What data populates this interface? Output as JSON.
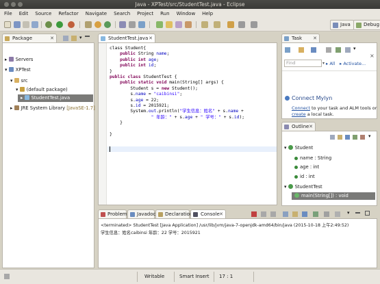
{
  "window": {
    "title": "Java - XPTest/src/StudentTest.java - Eclipse"
  },
  "menu": [
    "File",
    "Edit",
    "Source",
    "Refactor",
    "Navigate",
    "Search",
    "Project",
    "Run",
    "Window",
    "Help"
  ],
  "perspectives": {
    "java": "Java",
    "debug": "Debug"
  },
  "package_explorer": {
    "tab": "Package Explorer",
    "items": [
      "Servers",
      "XPTest",
      "src",
      "(default package)",
      "StudentTest.java",
      "JRE System Library",
      "[JavaSE-1.7]"
    ]
  },
  "editor": {
    "tab": "StudentTest.java",
    "lines": [
      [
        [
          "t",
          "class Student{"
        ]
      ],
      [
        [
          "t",
          "    "
        ],
        [
          "k",
          "public"
        ],
        [
          "t",
          " String "
        ],
        [
          "f",
          "name"
        ],
        [
          "t",
          ";"
        ]
      ],
      [
        [
          "t",
          "    "
        ],
        [
          "k",
          "public"
        ],
        [
          "t",
          " "
        ],
        [
          "k",
          "int"
        ],
        [
          "t",
          " "
        ],
        [
          "f",
          "age"
        ],
        [
          "t",
          ";"
        ]
      ],
      [
        [
          "t",
          "    "
        ],
        [
          "k",
          "public"
        ],
        [
          "t",
          " "
        ],
        [
          "k",
          "int"
        ],
        [
          "t",
          " "
        ],
        [
          "f",
          "id"
        ],
        [
          "t",
          ";"
        ]
      ],
      [
        [
          "t",
          "}"
        ]
      ],
      [
        [
          "k",
          "public"
        ],
        [
          "t",
          " "
        ],
        [
          "k",
          "class"
        ],
        [
          "t",
          " StudentTest {"
        ]
      ],
      [
        [
          "t",
          "    "
        ],
        [
          "k",
          "public"
        ],
        [
          "t",
          " "
        ],
        [
          "k",
          "static"
        ],
        [
          "t",
          " "
        ],
        [
          "k",
          "void"
        ],
        [
          "t",
          " main(String[] args) {"
        ]
      ],
      [
        [
          "t",
          "        Student s = "
        ],
        [
          "k",
          "new"
        ],
        [
          "t",
          " Student();"
        ]
      ],
      [
        [
          "t",
          "        s."
        ],
        [
          "f",
          "name"
        ],
        [
          "t",
          " = "
        ],
        [
          "s",
          "\"caibinsi\""
        ],
        [
          "t",
          ";"
        ]
      ],
      [
        [
          "t",
          "        s."
        ],
        [
          "f",
          "age"
        ],
        [
          "t",
          " = 22;"
        ]
      ],
      [
        [
          "t",
          "        s."
        ],
        [
          "f",
          "id"
        ],
        [
          "t",
          " = 2015921;"
        ]
      ],
      [
        [
          "t",
          "        System."
        ],
        [
          "f",
          "out"
        ],
        [
          "t",
          ".println("
        ],
        [
          "s",
          "\"学生信息：姓名\""
        ],
        [
          "t",
          " + s."
        ],
        [
          "f",
          "name"
        ],
        [
          "t",
          " +"
        ]
      ],
      [
        [
          "t",
          "                "
        ],
        [
          "s",
          "\" 年龄：\""
        ],
        [
          "t",
          " + s."
        ],
        [
          "f",
          "age"
        ],
        [
          "t",
          " + "
        ],
        [
          "s",
          "\" 学号：\""
        ],
        [
          "t",
          " + s."
        ],
        [
          "f",
          "id"
        ],
        [
          "t",
          ");"
        ]
      ],
      [
        [
          "t",
          "    }"
        ]
      ],
      [
        [
          "t",
          ""
        ]
      ],
      [
        [
          "t",
          "}"
        ]
      ],
      [
        [
          "t",
          ""
        ]
      ]
    ]
  },
  "task_list": {
    "tab": "Task List",
    "find_placeholder": "Find",
    "all_label": "All",
    "activate_label": "Activate...",
    "mylyn_title": "Connect Mylyn",
    "mylyn_text_1a": "Connect",
    "mylyn_text_1b": " to your task and ALM tools or",
    "mylyn_text_2a": "create",
    "mylyn_text_2b": " a local task."
  },
  "outline": {
    "tab": "Outline",
    "items": [
      "Student",
      "name : String",
      "age : int",
      "id : int",
      "StudentTest",
      "main(String[]) : void"
    ]
  },
  "bottom_tabs": [
    "Problems",
    "Javadoc",
    "Declaration",
    "Console"
  ],
  "console": {
    "header": "<terminated> StudentTest [Java Application] /usr/lib/jvm/java-7-openjdk-amd64/bin/java (2015-10-18 上午2:49:52)",
    "output": "学生信息：姓名caibinsi 年龄：22 学号：2015921"
  },
  "status": {
    "writable": "Writable",
    "insert_mode": "Smart Insert",
    "position": "17 : 1"
  }
}
